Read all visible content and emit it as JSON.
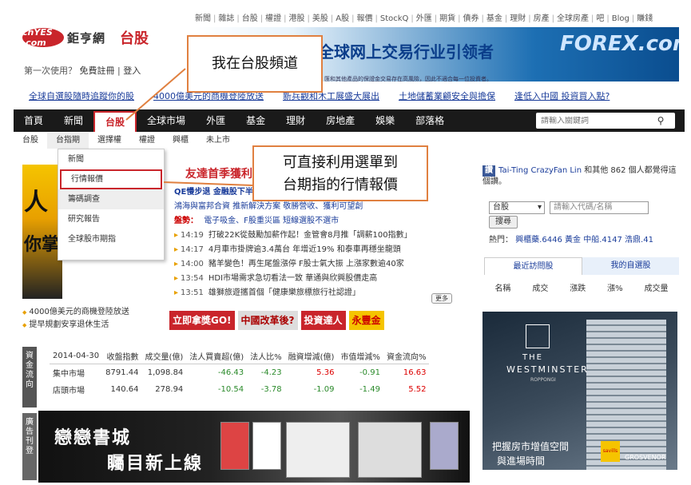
{
  "top_links": [
    "新聞",
    "雜誌",
    "台股",
    "權證",
    "港股",
    "美股",
    "A股",
    "報價",
    "StockQ",
    "外匯",
    "期貨",
    "債券",
    "基金",
    "理財",
    "房產",
    "全球房產",
    "吧",
    "Blog",
    "賺錢"
  ],
  "logo": {
    "badge": "cnYES .com",
    "name": "鉅亨網",
    "section": "台股"
  },
  "first_time": {
    "text": "第一次使用？",
    "register": "免費註冊",
    "login": "登入"
  },
  "banner": {
    "headline": "全球网上交易行业引领者",
    "small": "匯和其他產品的保證金交易存在高風險，因此不適合每一位投資者。",
    "brand": "FOREX.com"
  },
  "ticker": [
    "全球自選股隨時追蹤你的股",
    "4000億美元的商機登陸放送",
    "新兵觀和木工展盛大展出",
    "土地儲蓄業顧安全與擔保",
    "逢低入中國 投資買入點?"
  ],
  "nav": {
    "items": [
      "首頁",
      "新聞",
      "台股",
      "全球市場",
      "外匯",
      "基金",
      "理財",
      "房地產",
      "娛樂",
      "部落格"
    ],
    "active": "台股",
    "search_placeholder": "請輸入關鍵詞"
  },
  "subnav": [
    "台股",
    "台指期",
    "選擇權",
    "權證",
    "興櫃",
    "未上市"
  ],
  "dropdown": [
    "新聞",
    "行情報價",
    "籌碼調查",
    "研究報告",
    "全球股市期指"
  ],
  "callouts": {
    "c1": "我在台股頻道",
    "c2_line1": "可直接利用選單到",
    "c2_line2": "台期指的行情報價"
  },
  "left_promo": {
    "t1": "人",
    "t2": "你掌",
    "links": [
      "4000億美元的商機登陸放送",
      "提早規劃安享退休生活"
    ]
  },
  "headline": "友達首季獲利",
  "news": {
    "qe_line": "QE慢步退 金融股下半年",
    "line2": "鴻海與富邦合資 推新解決方案",
    "line2b": "敬勝營收、獲利可望創",
    "line3_label": "盤勢：",
    "line3": "電子吸金、F股重災區 短線選股不選市",
    "items": [
      {
        "time": "14:19",
        "title": "打破22K從鼓勵加薪作起！金管會8月推「調薪100指數」"
      },
      {
        "time": "14:17",
        "title": "4月車市掛牌逾3.4萬台 年增近19% 和泰車再穩坐龍頭"
      },
      {
        "time": "14:00",
        "title": "豬羊變色！再生尾盤漲停 F股士氣大振 上漲家數逾40家"
      },
      {
        "time": "13:54",
        "title": "HDI市場需求急切看法一致 華通與欣興股價走高"
      },
      {
        "time": "13:51",
        "title": "雄獅旅遊攜首個「健康樂旅標旅行社認證」"
      }
    ],
    "more": "更多"
  },
  "ad_strip": [
    "立即拿獎GO!",
    "中國改革後?",
    "投資達人",
    "永豐金"
  ],
  "market_side": "資金流向",
  "market": {
    "headers": [
      "2014-04-30",
      "收盤指數",
      "成交量(億)",
      "法人買賣超(億)",
      "法人比%",
      "融資增減(億)",
      "市值增減%",
      "資金流向%"
    ],
    "rows": [
      {
        "name": "集中市場",
        "vals": [
          "8791.44",
          "1,098.84",
          "-46.43",
          "-4.23",
          "5.36",
          "-0.91",
          "16.63"
        ]
      },
      {
        "name": "店頭市場",
        "vals": [
          "140.64",
          "278.94",
          "-10.54",
          "-3.78",
          "-1.09",
          "-1.49",
          "5.52"
        ]
      }
    ]
  },
  "ad_side": "廣告刊登",
  "book_ad": {
    "t1": "戀戀書城",
    "t2": "矚目新上線"
  },
  "facebook": {
    "badge": "讚",
    "name": "Tai-Ting CrazyFan Lin",
    "rest": " 和其他 862 個人都覺得這個讚。"
  },
  "quote": {
    "select": "台股",
    "placeholder": "請輸入代碼/名稱",
    "button": "搜尋",
    "hot_label": "熱門：",
    "hot": "興櫃藥.6446",
    "hot2": "黃金",
    "hot3": "中船.4147",
    "hot4": "浩鼎.41"
  },
  "watch_tabs": [
    "最近訪問股",
    "我的自選股"
  ],
  "watch_cols": [
    "名稱",
    "成交",
    "漲跌",
    "漲%",
    "成交量"
  ],
  "right_ad": {
    "t1": "THE",
    "t2": "WESTMINSTER",
    "t3": "ROPPONGI",
    "c1": "把握房市增值空間",
    "c2": "與進場時間",
    "sav": "savills",
    "gro": "GROSVENOR"
  },
  "colors": {
    "accent": "#c9252b",
    "nav_bg": "#1a1a1a",
    "link": "#1a3c9a",
    "callout_border": "#e08040"
  }
}
